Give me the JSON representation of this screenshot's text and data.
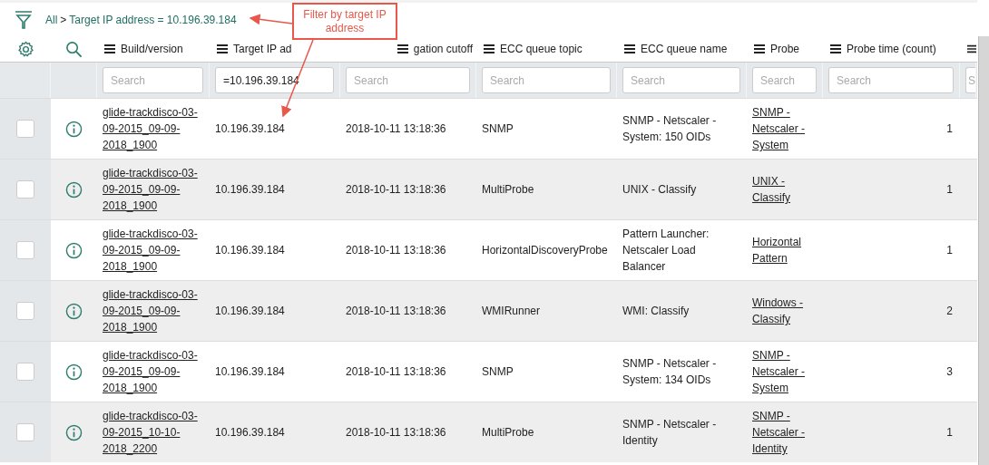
{
  "breadcrumb": {
    "items": [
      "All",
      "Target IP address = 10.196.39.184"
    ],
    "separator": ">"
  },
  "callout": {
    "text": "Filter by target IP address"
  },
  "columns": [
    {
      "label": "Build/version",
      "search_placeholder": "Search"
    },
    {
      "label": "Target IP ad",
      "search_value": "=10.196.39.184"
    },
    {
      "label": "gation cutoff",
      "search_placeholder": "Search"
    },
    {
      "label": "ECC queue topic",
      "search_placeholder": "Search"
    },
    {
      "label": "ECC queue name",
      "search_placeholder": "Search"
    },
    {
      "label": "Probe",
      "search_placeholder": "Search"
    },
    {
      "label": "Probe time (count)",
      "search_placeholder": "Search"
    },
    {
      "search_placeholder": "S"
    }
  ],
  "rows": [
    {
      "checked": false,
      "build": "glide-trackdisco-03-09-2015_09-09-2018_1900",
      "ip": "10.196.39.184",
      "cutoff": "2018-10-11 13:18:36",
      "topic": "SNMP",
      "queue_name": "SNMP - Netscaler - System: 150 OIDs",
      "probe": "SNMP - Netscaler - System",
      "count": "1"
    },
    {
      "checked": false,
      "build": "glide-trackdisco-03-09-2015_09-09-2018_1900",
      "ip": "10.196.39.184",
      "cutoff": "2018-10-11 13:18:36",
      "topic": "MultiProbe",
      "queue_name": "UNIX - Classify",
      "probe": "UNIX - Classify",
      "count": "1"
    },
    {
      "checked": false,
      "build": "glide-trackdisco-03-09-2015_09-09-2018_1900",
      "ip": "10.196.39.184",
      "cutoff": "2018-10-11 13:18:36",
      "topic": "HorizontalDiscoveryProbe",
      "queue_name": "Pattern Launcher: Netscaler Load Balancer",
      "probe": "Horizontal Pattern",
      "count": "1"
    },
    {
      "checked": false,
      "build": "glide-trackdisco-03-09-2015_09-09-2018_1900",
      "ip": "10.196.39.184",
      "cutoff": "2018-10-11 13:18:36",
      "topic": "WMIRunner",
      "queue_name": "WMI: Classify",
      "probe": "Windows - Classify",
      "count": "2"
    },
    {
      "checked": false,
      "build": "glide-trackdisco-03-09-2015_09-09-2018_1900",
      "ip": "10.196.39.184",
      "cutoff": "2018-10-11 13:18:36",
      "topic": "SNMP",
      "queue_name": "SNMP - Netscaler - System: 134 OIDs",
      "probe": "SNMP - Netscaler - System",
      "count": "3"
    },
    {
      "checked": false,
      "build": "glide-trackdisco-03-09-2015_10-10-2018_2200",
      "ip": "10.196.39.184",
      "cutoff": "2018-10-11 13:18:36",
      "topic": "MultiProbe",
      "queue_name": "SNMP - Netscaler - Identity",
      "probe": "SNMP - Netscaler - Identity",
      "count": "1"
    }
  ]
}
